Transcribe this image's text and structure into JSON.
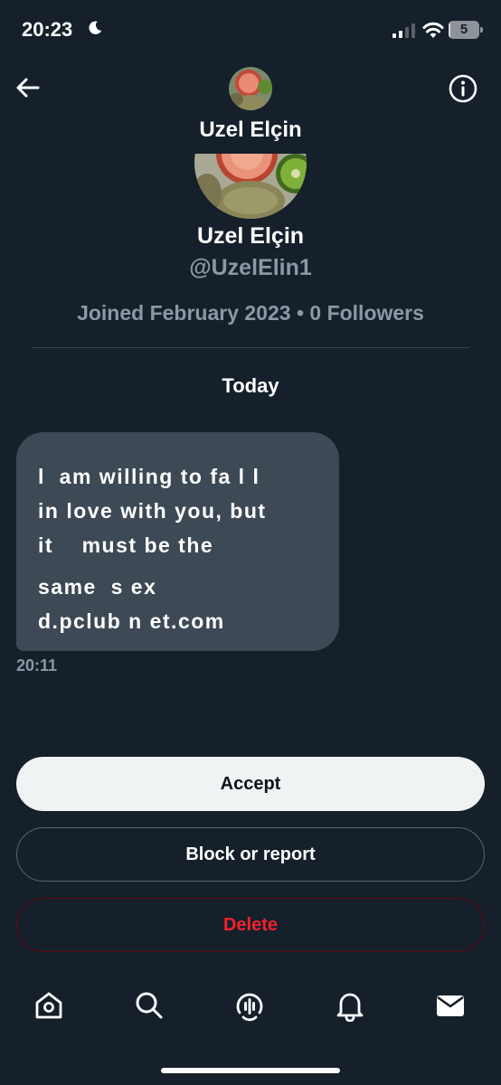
{
  "status_bar": {
    "time": "20:23",
    "battery_level": "5"
  },
  "header": {
    "name": "Uzel Elçin"
  },
  "profile": {
    "name": "Uzel Elçin",
    "handle": "@UzelElin1",
    "meta": "Joined February 2023 • 0 Followers"
  },
  "conversation": {
    "date_label": "Today",
    "message": {
      "lines": [
        "l  am willing to fa l l",
        "in love with you, but",
        "it    must be the",
        "same  s ex",
        "d.pclub n et.com"
      ],
      "time": "20:11"
    }
  },
  "actions": {
    "accept": "Accept",
    "block": "Block or report",
    "delete": "Delete"
  },
  "nav": {
    "items": [
      "home-icon",
      "search-icon",
      "spaces-icon",
      "notifications-icon",
      "messages-icon"
    ]
  },
  "colors": {
    "background": "#15202b",
    "bubble": "#3d4955",
    "secondary_text": "#8b98a5",
    "delete_red": "#f4212e"
  }
}
